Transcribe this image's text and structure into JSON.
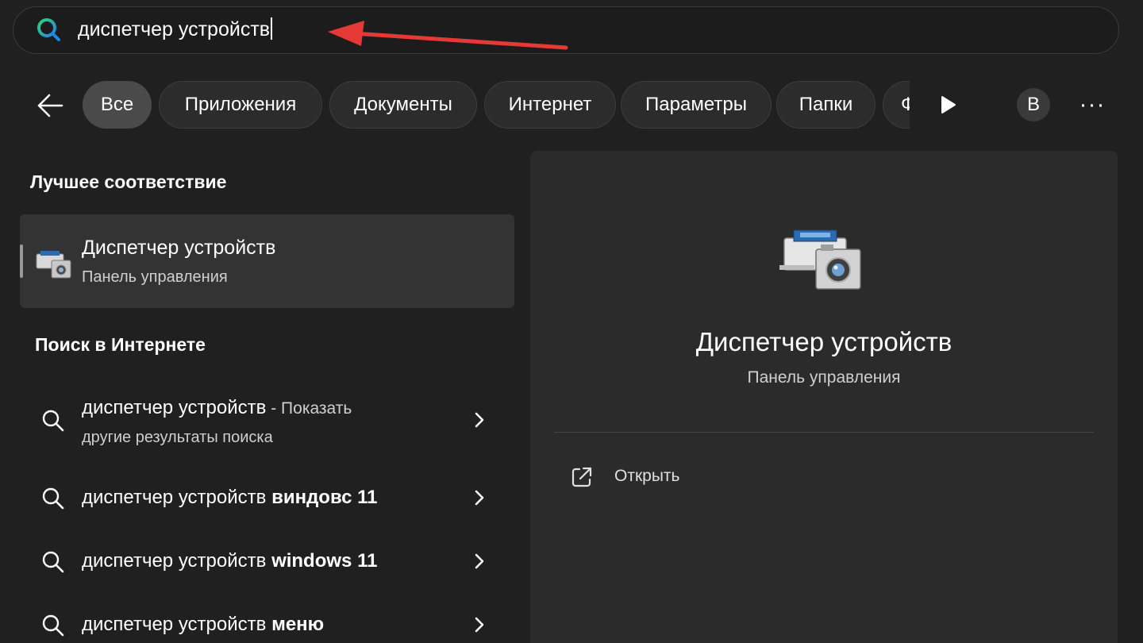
{
  "search": {
    "query": "диспетчер устройств"
  },
  "filters": {
    "chips": [
      "Все",
      "Приложения",
      "Документы",
      "Интернет",
      "Параметры",
      "Папки",
      "Ф"
    ],
    "active_index": 0,
    "avatar_letter": "В",
    "more_label": "···"
  },
  "best_match": {
    "section_title": "Лучшее соответствие",
    "title": "Диспетчер устройств",
    "subtitle": "Панель управления"
  },
  "web_search": {
    "section_title": "Поиск в Интернете",
    "rows": [
      {
        "prefix": "диспетчер устройств",
        "suffix": " - Показать",
        "second_line": "другие результаты поиска"
      },
      {
        "prefix": "диспетчер устройств ",
        "bold": "виндовс 11"
      },
      {
        "prefix": "диспетчер устройств ",
        "bold": "windows 11"
      },
      {
        "prefix": "диспетчер устройств ",
        "bold": "меню"
      }
    ]
  },
  "detail": {
    "title": "Диспетчер устройств",
    "subtitle": "Панель управления",
    "actions": [
      {
        "icon": "open-external-icon",
        "label": "Открыть"
      }
    ]
  },
  "colors": {
    "background": "#202020",
    "panel": "#2b2b2b",
    "annotation_arrow": "#e53935"
  }
}
